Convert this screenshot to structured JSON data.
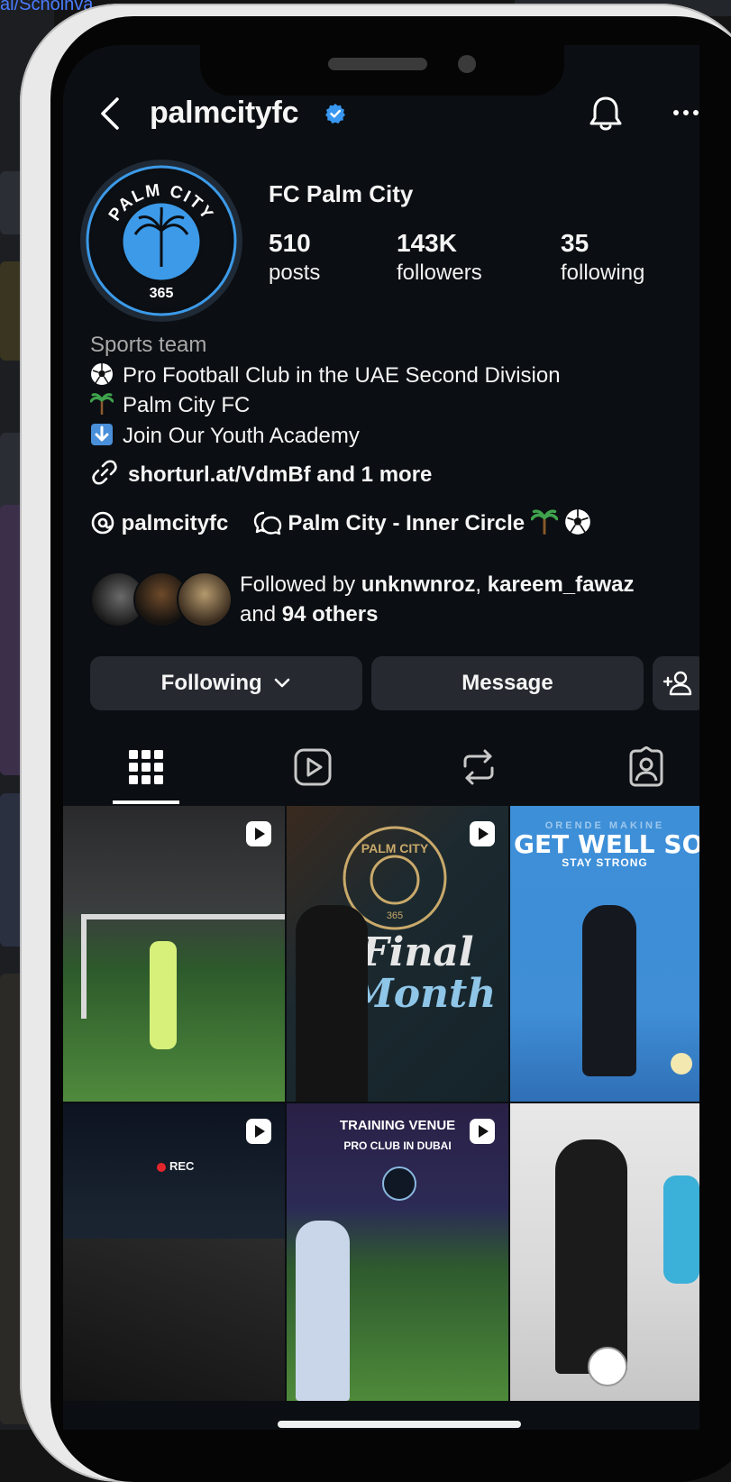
{
  "background": {
    "top_link_fragment": "al/Scholhva"
  },
  "header": {
    "handle": "palmcityfc",
    "back_icon": "chevron-left-icon",
    "verified_icon": "verified-badge-icon",
    "bell_icon": "bell-icon",
    "more_icon": "more-horizontal-icon"
  },
  "profile": {
    "display_name": "FC Palm City",
    "avatar_text_top": "PALM CITY",
    "avatar_text_bottom": "365",
    "stats": [
      {
        "value": "510",
        "label": "posts"
      },
      {
        "value": "143K",
        "label": "followers"
      },
      {
        "value": "35",
        "label": "following"
      }
    ],
    "category": "Sports team",
    "bio_lines": [
      "Pro Football Club in the UAE Second Division",
      "Palm City FC",
      "Join Our Youth Academy"
    ],
    "link": "shorturl.at/VdmBf and 1 more",
    "threads_handle": "palmcityfc",
    "channel_name": "Palm City - Inner Circle"
  },
  "followed_by": {
    "prefix": "Followed by ",
    "user1": "unknwnroz",
    "sep": ", ",
    "user2": "kareem_fawaz",
    "and": "and ",
    "others": "94 others"
  },
  "actions": {
    "following": "Following",
    "message": "Message"
  },
  "tabs": [
    {
      "name": "grid",
      "icon": "grid-icon",
      "active": true
    },
    {
      "name": "reels",
      "icon": "reels-icon"
    },
    {
      "name": "reposts",
      "icon": "repost-icon"
    },
    {
      "name": "tagged",
      "icon": "tagged-icon"
    }
  ],
  "posts": [
    {
      "type": "reel",
      "caption": ""
    },
    {
      "type": "reel",
      "line1": "Final",
      "line2": "Month",
      "crest_top": "PALM CITY",
      "crest_bottom": "365"
    },
    {
      "type": "image",
      "title": "GET WELL SOO",
      "kicker": "ORENDE MAKINE",
      "subtitle": "STAY STRONG"
    },
    {
      "type": "reel",
      "badge": "REC"
    },
    {
      "type": "reel",
      "title": "TRAINING VENUE",
      "subtitle": "PRO CLUB IN DUBAI"
    },
    {
      "type": "image"
    }
  ],
  "colors": {
    "screen_bg": "#0b0e12",
    "button_bg": "#262a30",
    "verified": "#3897f0",
    "club_blue": "#3c9ae8",
    "text_muted": "#a8a8a8"
  }
}
